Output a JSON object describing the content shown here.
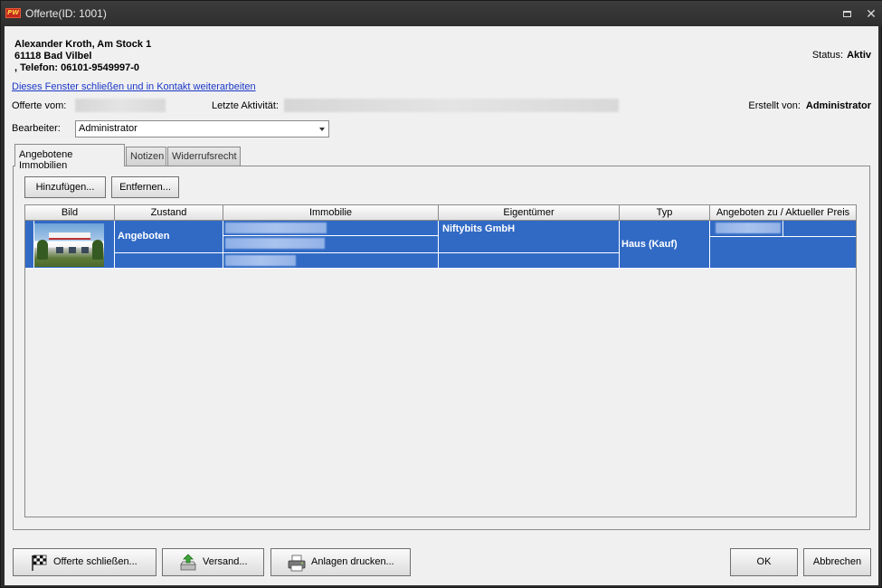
{
  "window": {
    "logo_text": "PW",
    "title": "Offerte(ID: 1001)"
  },
  "contact": {
    "line1": "Alexander Kroth, Am Stock 1",
    "line2": "61118 Bad Vilbel",
    "line3": ", Telefon: 06101-9549997-0"
  },
  "status": {
    "label": "Status:",
    "value": "Aktiv"
  },
  "link_text": "Dieses Fenster schließen und in Kontakt weiterarbeiten",
  "info": {
    "offer_from_label": "Offerte vom:",
    "last_activity_label": "Letzte Aktivität:",
    "created_by_label": "Erstellt von:",
    "created_by_value": "Administrator"
  },
  "editor": {
    "label": "Bearbeiter:",
    "value": "Administrator"
  },
  "tabs": [
    {
      "label": "Angebotene Immobilien",
      "active": true
    },
    {
      "label": "Notizen",
      "active": false
    },
    {
      "label": "Widerrufsrecht",
      "active": false
    }
  ],
  "toolbar": {
    "add_label": "Hinzufügen...",
    "remove_label": "Entfernen..."
  },
  "grid": {
    "columns": [
      "Bild",
      "Zustand",
      "Immobilie",
      "Eigentümer",
      "Typ",
      "Angeboten zu / Aktueller Preis"
    ],
    "rows": [
      {
        "zustand": "Angeboten",
        "eigentuemer": "Niftybits GmbH",
        "typ": "Haus (Kauf)"
      }
    ],
    "selection_color": "#316ac5"
  },
  "buttons": {
    "close_offer": "Offerte schließen...",
    "send": "Versand...",
    "print": "Anlagen drucken...",
    "ok": "OK",
    "cancel": "Abbrechen"
  },
  "icons": {
    "close_offer": "checkered-flag-icon",
    "send": "send-tray-icon",
    "print": "printer-icon"
  }
}
